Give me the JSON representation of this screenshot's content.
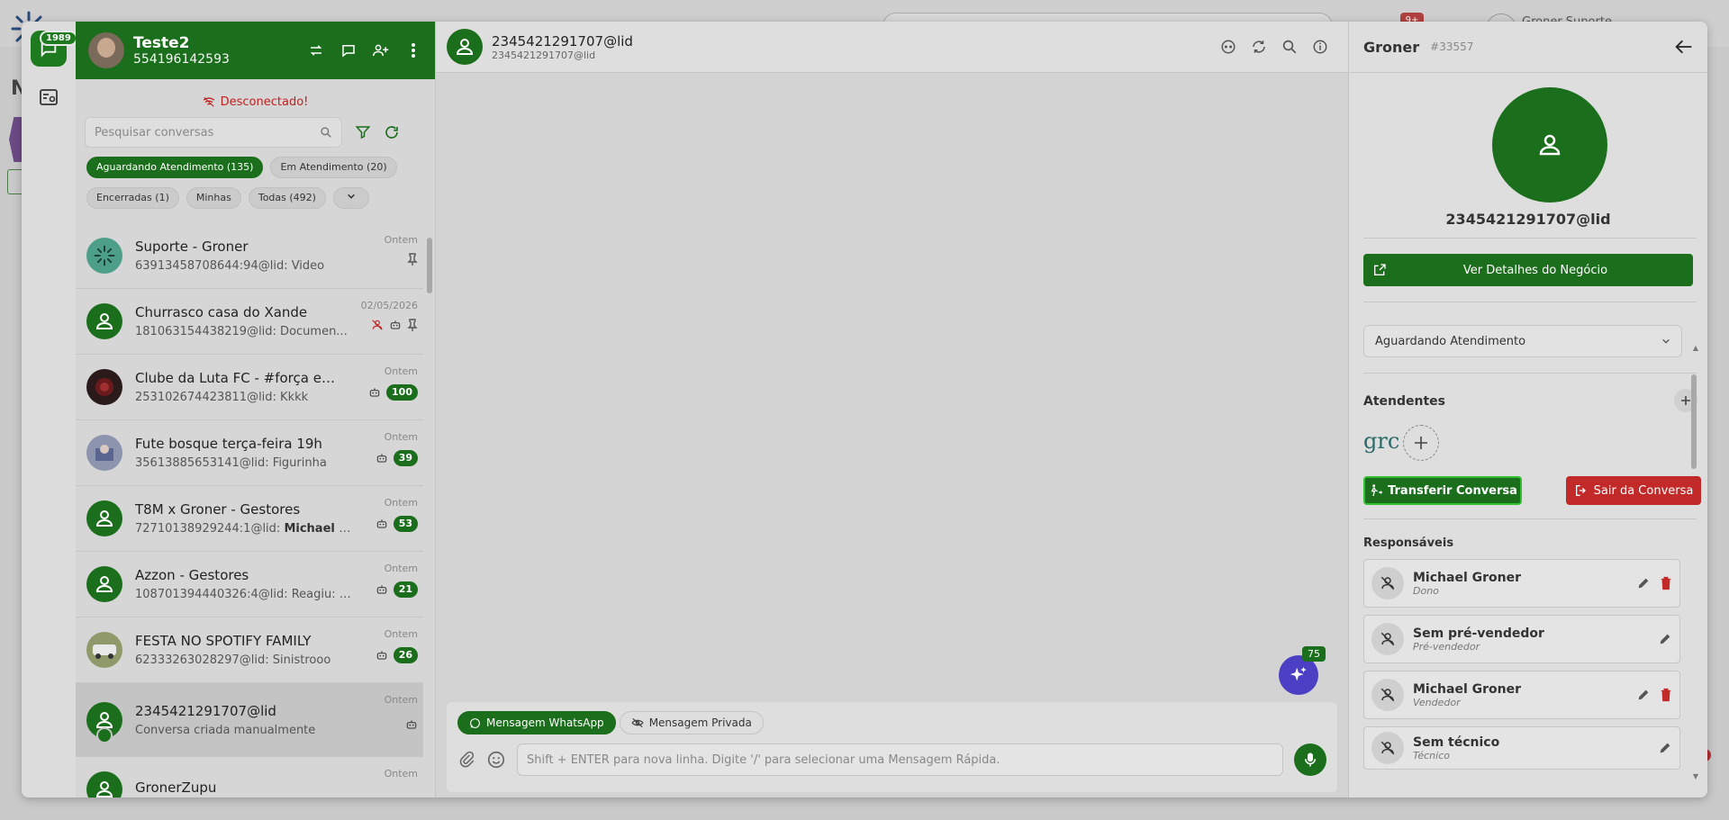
{
  "background": {
    "user_name": "Groner Suporte",
    "badge": "9+",
    "heading_letter": "N"
  },
  "rail": {
    "chat_badge": "1989"
  },
  "account": {
    "name": "Teste2",
    "phone": "554196142593"
  },
  "connection_status": "Desconectado!",
  "search": {
    "placeholder": "Pesquisar conversas"
  },
  "filters": [
    {
      "label": "Aguardando Atendimento (135)",
      "active": true
    },
    {
      "label": "Em Atendimento (20)",
      "active": false
    },
    {
      "label": "Encerradas (1)",
      "active": false
    },
    {
      "label": "Minhas",
      "active": false
    },
    {
      "label": "Todas (492)",
      "active": false
    }
  ],
  "conversations": [
    {
      "title": "Suporte - Groner",
      "sub": "63913458708644:94@lid: Video",
      "date": "Ontem",
      "count": ""
    },
    {
      "title": "Churrasco casa do Xande",
      "sub": "181063154438219@lid: Documen...",
      "date": "02/05/2026",
      "count": ""
    },
    {
      "title": "Clube da Luta FC - #força enam...",
      "sub": "253102674423811@lid: Kkkk",
      "date": "Ontem",
      "count": "100"
    },
    {
      "title": "Fute bosque terça-feira 19h",
      "sub": "35613885653141@lid: Figurinha",
      "date": "Ontem",
      "count": "39"
    },
    {
      "title": "T8M x Groner - Gestores",
      "sub_prefix": "72710138929244:1@lid: ",
      "sub_bold": "Michael Gr...",
      "date": "Ontem",
      "count": "53"
    },
    {
      "title": "Azzon - Gestores",
      "sub": "108701394440326:4@lid: Reagiu: 🙏",
      "date": "Ontem",
      "count": "21"
    },
    {
      "title": "FESTA NO SPOTIFY FAMILY",
      "sub": "62333263028297@lid: Sinistrooo",
      "date": "Ontem",
      "count": "26"
    },
    {
      "title": "2345421291707@lid",
      "sub": "Conversa criada manualmente",
      "date": "Ontem",
      "count": ""
    },
    {
      "title": "GronerZupu",
      "sub": "",
      "date": "Ontem",
      "count": ""
    }
  ],
  "chat": {
    "name": "2345421291707@lid",
    "sub": "2345421291707@lid",
    "ai_badge": "75",
    "tab_whatsapp": "Mensagem WhatsApp",
    "tab_private": "Mensagem Privada",
    "input_placeholder": "Shift + ENTER para nova linha. Digite '/' para selecionar uma Mensagem Rápida."
  },
  "details": {
    "name": "Groner",
    "id": "#33557",
    "lid": "2345421291707@lid",
    "business_button": "Ver Detalhes do Negócio",
    "status": "Aguardando Atendimento",
    "attendants_title": "Atendentes",
    "agent_logo": "grc",
    "transfer_button": "Transferir Conversa",
    "leave_button": "Sair da Conversa",
    "responsibles_title": "Responsáveis",
    "responsibles": [
      {
        "name": "Michael Groner",
        "role": "Dono",
        "deletable": true
      },
      {
        "name": "Sem pré-vendedor",
        "role": "Pré-vendedor",
        "deletable": false
      },
      {
        "name": "Michael Groner",
        "role": "Vendedor",
        "deletable": true
      },
      {
        "name": "Sem técnico",
        "role": "Técnico",
        "deletable": false
      }
    ]
  },
  "colors": {
    "brand_green": "#1b6e1b",
    "danger_red": "#c22a2a",
    "ai_purple": "#4b3fc4"
  }
}
